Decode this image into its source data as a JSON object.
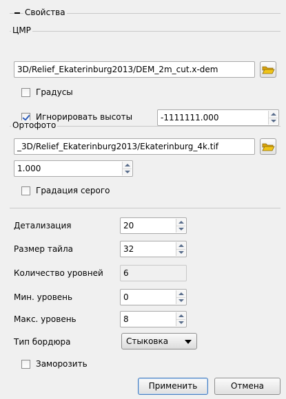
{
  "properties": {
    "title": "Свойства"
  },
  "dem": {
    "title": "ЦМР",
    "path": "3D/Relief_Ekaterinburg2013/DEM_2m_cut.x-dem",
    "degrees_label": "Градусы",
    "degrees_checked": false,
    "ignore_heights_label": "Игнорировать высоты",
    "ignore_heights_checked": true,
    "ignore_heights_value": "-1111111.000"
  },
  "orthophoto": {
    "title": "Ортофото",
    "path": "_3D/Relief_Ekaterinburg2013/Ekaterinburg_4k.tif",
    "scale_value": "1.000",
    "grayscale_label": "Градация серого",
    "grayscale_checked": false
  },
  "settings": {
    "detail_label": "Детализация",
    "detail_value": "20",
    "tile_size_label": "Размер тайла",
    "tile_size_value": "32",
    "levels_count_label": "Количество уровней",
    "levels_count_value": "6",
    "min_level_label": "Мин. уровень",
    "min_level_value": "0",
    "max_level_label": "Макс. уровень",
    "max_level_value": "8",
    "border_type_label": "Тип бордюра",
    "border_type_value": "Стыковка",
    "freeze_label": "Заморозить",
    "freeze_checked": false
  },
  "buttons": {
    "apply": "Применить",
    "cancel": "Отмена"
  },
  "icons": {
    "folder": "folder-open-icon",
    "collapse": "minus-icon",
    "spin": "spin-arrows-icon",
    "dropdown": "chevron-down-icon"
  },
  "colors": {
    "folder_fill": "#f0c419",
    "check_mark": "#2a5ab8",
    "spin_arrow": "#5a6e8c"
  }
}
